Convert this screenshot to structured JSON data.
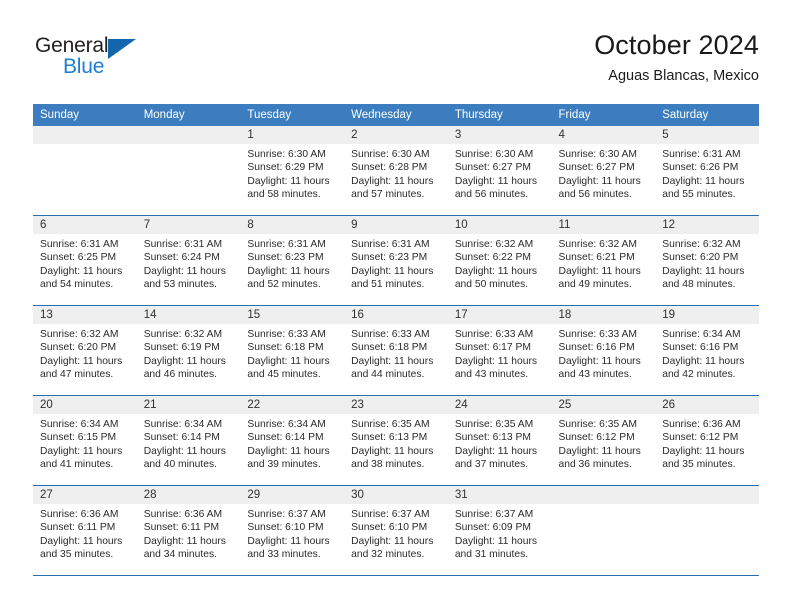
{
  "logo": {
    "word_top": "General",
    "word_bottom": "Blue",
    "triangle_color": "#1266ad",
    "blue_text_color": "#1f7fd4",
    "name": "general-blue-logo"
  },
  "header": {
    "month_title": "October 2024",
    "location": "Aguas Blancas, Mexico"
  },
  "theme": {
    "header_blue": "#3b7dbf",
    "divider_blue": "#2c6fb0",
    "daynum_band": "#efefef",
    "text": "#2b2b2b"
  },
  "weekday_headers": [
    "Sunday",
    "Monday",
    "Tuesday",
    "Wednesday",
    "Thursday",
    "Friday",
    "Saturday"
  ],
  "weeks": [
    [
      {
        "blank": true
      },
      {
        "blank": true
      },
      {
        "day": "1",
        "sunrise": "Sunrise: 6:30 AM",
        "sunset": "Sunset: 6:29 PM",
        "daylight_1": "Daylight: 11 hours",
        "daylight_2": "and 58 minutes."
      },
      {
        "day": "2",
        "sunrise": "Sunrise: 6:30 AM",
        "sunset": "Sunset: 6:28 PM",
        "daylight_1": "Daylight: 11 hours",
        "daylight_2": "and 57 minutes."
      },
      {
        "day": "3",
        "sunrise": "Sunrise: 6:30 AM",
        "sunset": "Sunset: 6:27 PM",
        "daylight_1": "Daylight: 11 hours",
        "daylight_2": "and 56 minutes."
      },
      {
        "day": "4",
        "sunrise": "Sunrise: 6:30 AM",
        "sunset": "Sunset: 6:27 PM",
        "daylight_1": "Daylight: 11 hours",
        "daylight_2": "and 56 minutes."
      },
      {
        "day": "5",
        "sunrise": "Sunrise: 6:31 AM",
        "sunset": "Sunset: 6:26 PM",
        "daylight_1": "Daylight: 11 hours",
        "daylight_2": "and 55 minutes."
      }
    ],
    [
      {
        "day": "6",
        "sunrise": "Sunrise: 6:31 AM",
        "sunset": "Sunset: 6:25 PM",
        "daylight_1": "Daylight: 11 hours",
        "daylight_2": "and 54 minutes."
      },
      {
        "day": "7",
        "sunrise": "Sunrise: 6:31 AM",
        "sunset": "Sunset: 6:24 PM",
        "daylight_1": "Daylight: 11 hours",
        "daylight_2": "and 53 minutes."
      },
      {
        "day": "8",
        "sunrise": "Sunrise: 6:31 AM",
        "sunset": "Sunset: 6:23 PM",
        "daylight_1": "Daylight: 11 hours",
        "daylight_2": "and 52 minutes."
      },
      {
        "day": "9",
        "sunrise": "Sunrise: 6:31 AM",
        "sunset": "Sunset: 6:23 PM",
        "daylight_1": "Daylight: 11 hours",
        "daylight_2": "and 51 minutes."
      },
      {
        "day": "10",
        "sunrise": "Sunrise: 6:32 AM",
        "sunset": "Sunset: 6:22 PM",
        "daylight_1": "Daylight: 11 hours",
        "daylight_2": "and 50 minutes."
      },
      {
        "day": "11",
        "sunrise": "Sunrise: 6:32 AM",
        "sunset": "Sunset: 6:21 PM",
        "daylight_1": "Daylight: 11 hours",
        "daylight_2": "and 49 minutes."
      },
      {
        "day": "12",
        "sunrise": "Sunrise: 6:32 AM",
        "sunset": "Sunset: 6:20 PM",
        "daylight_1": "Daylight: 11 hours",
        "daylight_2": "and 48 minutes."
      }
    ],
    [
      {
        "day": "13",
        "sunrise": "Sunrise: 6:32 AM",
        "sunset": "Sunset: 6:20 PM",
        "daylight_1": "Daylight: 11 hours",
        "daylight_2": "and 47 minutes."
      },
      {
        "day": "14",
        "sunrise": "Sunrise: 6:32 AM",
        "sunset": "Sunset: 6:19 PM",
        "daylight_1": "Daylight: 11 hours",
        "daylight_2": "and 46 minutes."
      },
      {
        "day": "15",
        "sunrise": "Sunrise: 6:33 AM",
        "sunset": "Sunset: 6:18 PM",
        "daylight_1": "Daylight: 11 hours",
        "daylight_2": "and 45 minutes."
      },
      {
        "day": "16",
        "sunrise": "Sunrise: 6:33 AM",
        "sunset": "Sunset: 6:18 PM",
        "daylight_1": "Daylight: 11 hours",
        "daylight_2": "and 44 minutes."
      },
      {
        "day": "17",
        "sunrise": "Sunrise: 6:33 AM",
        "sunset": "Sunset: 6:17 PM",
        "daylight_1": "Daylight: 11 hours",
        "daylight_2": "and 43 minutes."
      },
      {
        "day": "18",
        "sunrise": "Sunrise: 6:33 AM",
        "sunset": "Sunset: 6:16 PM",
        "daylight_1": "Daylight: 11 hours",
        "daylight_2": "and 43 minutes."
      },
      {
        "day": "19",
        "sunrise": "Sunrise: 6:34 AM",
        "sunset": "Sunset: 6:16 PM",
        "daylight_1": "Daylight: 11 hours",
        "daylight_2": "and 42 minutes."
      }
    ],
    [
      {
        "day": "20",
        "sunrise": "Sunrise: 6:34 AM",
        "sunset": "Sunset: 6:15 PM",
        "daylight_1": "Daylight: 11 hours",
        "daylight_2": "and 41 minutes."
      },
      {
        "day": "21",
        "sunrise": "Sunrise: 6:34 AM",
        "sunset": "Sunset: 6:14 PM",
        "daylight_1": "Daylight: 11 hours",
        "daylight_2": "and 40 minutes."
      },
      {
        "day": "22",
        "sunrise": "Sunrise: 6:34 AM",
        "sunset": "Sunset: 6:14 PM",
        "daylight_1": "Daylight: 11 hours",
        "daylight_2": "and 39 minutes."
      },
      {
        "day": "23",
        "sunrise": "Sunrise: 6:35 AM",
        "sunset": "Sunset: 6:13 PM",
        "daylight_1": "Daylight: 11 hours",
        "daylight_2": "and 38 minutes."
      },
      {
        "day": "24",
        "sunrise": "Sunrise: 6:35 AM",
        "sunset": "Sunset: 6:13 PM",
        "daylight_1": "Daylight: 11 hours",
        "daylight_2": "and 37 minutes."
      },
      {
        "day": "25",
        "sunrise": "Sunrise: 6:35 AM",
        "sunset": "Sunset: 6:12 PM",
        "daylight_1": "Daylight: 11 hours",
        "daylight_2": "and 36 minutes."
      },
      {
        "day": "26",
        "sunrise": "Sunrise: 6:36 AM",
        "sunset": "Sunset: 6:12 PM",
        "daylight_1": "Daylight: 11 hours",
        "daylight_2": "and 35 minutes."
      }
    ],
    [
      {
        "day": "27",
        "sunrise": "Sunrise: 6:36 AM",
        "sunset": "Sunset: 6:11 PM",
        "daylight_1": "Daylight: 11 hours",
        "daylight_2": "and 35 minutes."
      },
      {
        "day": "28",
        "sunrise": "Sunrise: 6:36 AM",
        "sunset": "Sunset: 6:11 PM",
        "daylight_1": "Daylight: 11 hours",
        "daylight_2": "and 34 minutes."
      },
      {
        "day": "29",
        "sunrise": "Sunrise: 6:37 AM",
        "sunset": "Sunset: 6:10 PM",
        "daylight_1": "Daylight: 11 hours",
        "daylight_2": "and 33 minutes."
      },
      {
        "day": "30",
        "sunrise": "Sunrise: 6:37 AM",
        "sunset": "Sunset: 6:10 PM",
        "daylight_1": "Daylight: 11 hours",
        "daylight_2": "and 32 minutes."
      },
      {
        "day": "31",
        "sunrise": "Sunrise: 6:37 AM",
        "sunset": "Sunset: 6:09 PM",
        "daylight_1": "Daylight: 11 hours",
        "daylight_2": "and 31 minutes."
      },
      {
        "blank": true
      },
      {
        "blank": true
      }
    ]
  ]
}
